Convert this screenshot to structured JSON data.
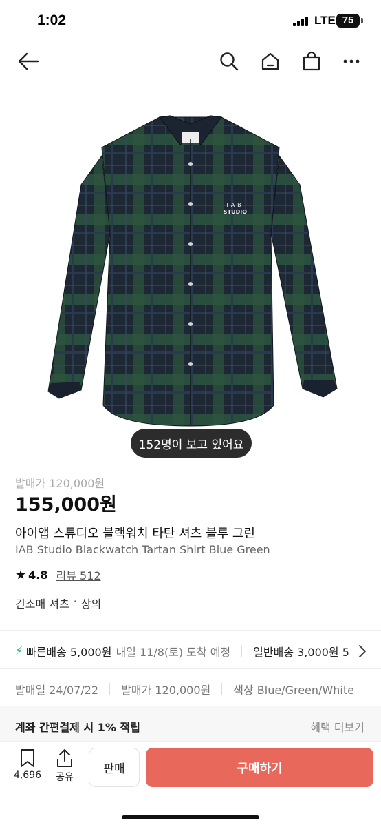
{
  "status": {
    "time": "1:02",
    "network": "LTE",
    "battery": "75"
  },
  "product": {
    "viewers": "152명이 보고 있어요",
    "logo_text": "IAB\nSTUDIO",
    "original_price": "발매가 120,000원",
    "price": "155,000원",
    "title_ko": "아이앱 스튜디오 블랙워치 타탄 셔츠 블루 그린",
    "title_en": "IAB Studio Blackwatch Tartan Shirt Blue Green",
    "rating": "4.8",
    "review_label": "리뷰 512",
    "categories": [
      "긴소매 셔츠",
      "상의"
    ],
    "category_separator": "·"
  },
  "delivery": {
    "fast_label": "빠른배송 5,000원",
    "fast_eta": "내일 11/8(토) 도착 예정",
    "normal_label": "일반배송 3,000원 5"
  },
  "info": {
    "release_date": "발매일 24/07/22",
    "release_price": "발매가 120,000원",
    "color": "색상 Blue/Green/White"
  },
  "promo": {
    "text": "계좌 간편결제 시 1% 적립",
    "more": "혜택 더보기"
  },
  "bottom": {
    "bookmark_count": "4,696",
    "share_label": "공유",
    "sell_label": "판매",
    "buy_label": "구매하기"
  },
  "colors": {
    "buy": "#e8685c",
    "fast_delivery": "#3ab77c",
    "shirt_base": "#1f2a36",
    "shirt_green": "#2e5a42"
  }
}
